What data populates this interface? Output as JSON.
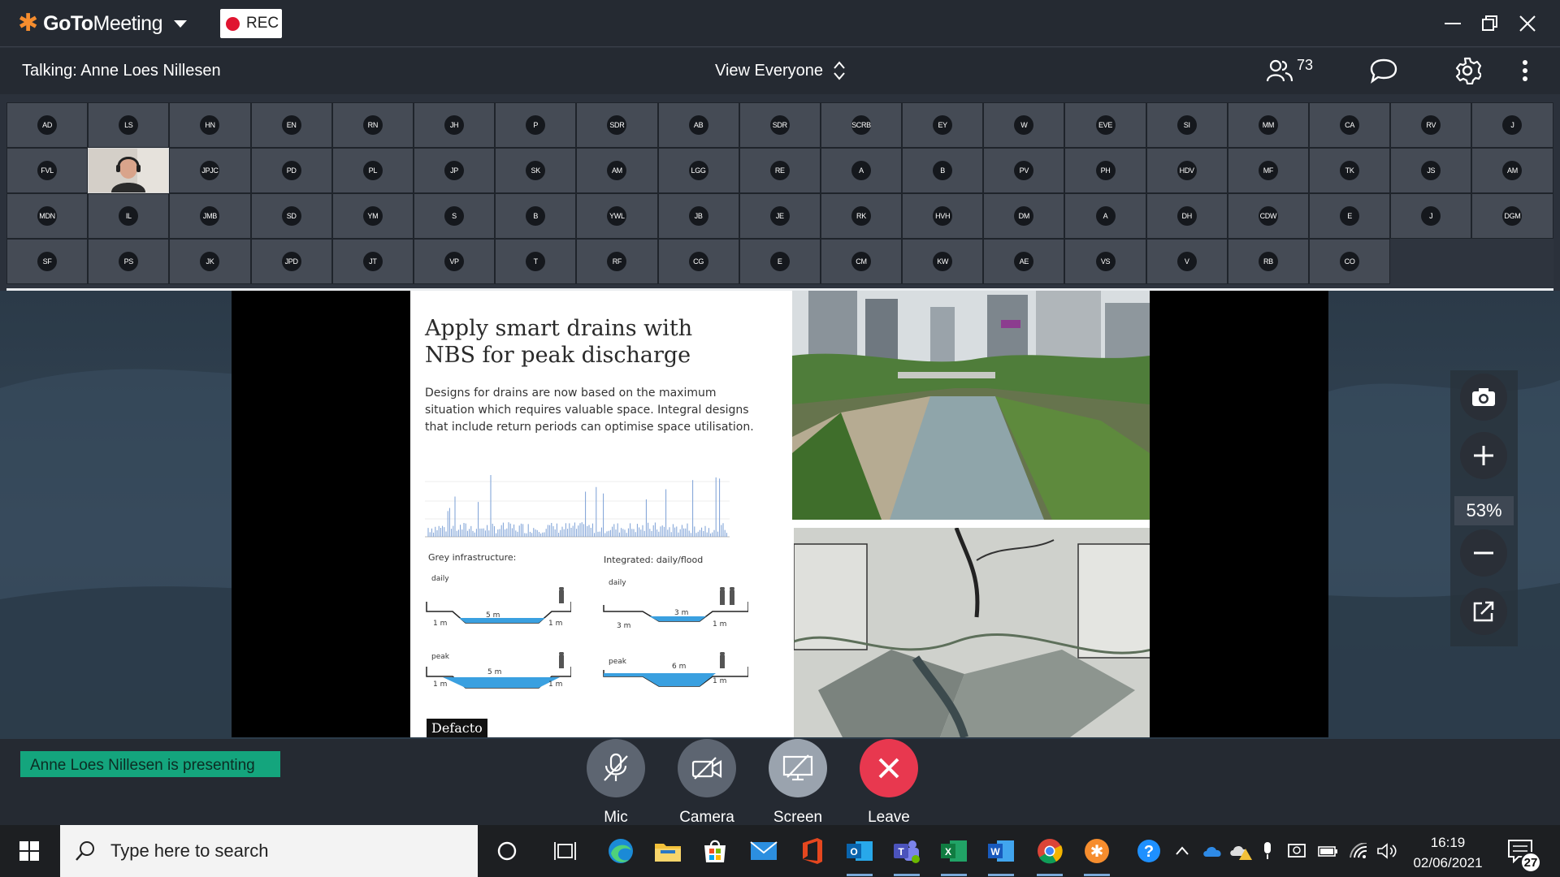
{
  "app": {
    "name_bold": "GoTo",
    "name_rest": "Meeting",
    "rec_label": "REC"
  },
  "infobar": {
    "talking": "Talking: Anne Loes Nillesen",
    "view_label": "View Everyone",
    "attendee_count": "73"
  },
  "participants": [
    "AD",
    "LS",
    "HN",
    "EN",
    "RN",
    "JH",
    "P",
    "SDR",
    "AB",
    "SDR",
    "SCRB",
    "EY",
    "W",
    "EVE",
    "SI",
    "MM",
    "CA",
    "RV",
    "J",
    "FVL",
    "",
    "JPJC",
    "PD",
    "PL",
    "JP",
    "SK",
    "AM",
    "LGG",
    "RE",
    "A",
    "B",
    "PV",
    "PH",
    "HDV",
    "MF",
    "TK",
    "JS",
    "AM",
    "MDN",
    "IL",
    "JMB",
    "SD",
    "YM",
    "S",
    "B",
    "YWL",
    "JB",
    "JE",
    "RK",
    "HVH",
    "DM",
    "A",
    "DH",
    "CDW",
    "E",
    "J",
    "DGM",
    "SF",
    "PS",
    "JK",
    "JPD",
    "JT",
    "VP",
    "T",
    "RF",
    "CG",
    "E",
    "CM",
    "KW",
    "AE",
    "VS",
    "V",
    "RB",
    "CO"
  ],
  "slide": {
    "title_line1": "Apply smart drains with",
    "title_line2": "NBS for peak discharge",
    "body": "Designs for drains are now based on the maximum situation which requires valuable space. Integral designs that include return periods can optimise space utilisation.",
    "grey_label": "Grey infrastructure:",
    "integrated_label": "Integrated: daily/flood",
    "daily": "daily",
    "peak": "peak",
    "m5": "5 m",
    "m3": "3 m",
    "m6": "6 m",
    "m1": "1 m",
    "brand": "Defacto"
  },
  "zoom": {
    "percent": "53%"
  },
  "bottom": {
    "presenting": "Anne Loes Nillesen is presenting",
    "mic": "Mic",
    "camera": "Camera",
    "screen": "Screen",
    "leave": "Leave"
  },
  "taskbar": {
    "search_placeholder": "Type here to search",
    "time": "16:19",
    "date": "02/06/2021",
    "notifications": "27"
  },
  "colors": {
    "accent_orange": "#f68d2e",
    "rec_red": "#e01530",
    "presenting_green": "#14a57d",
    "leave_red": "#e8384f"
  },
  "icons": [
    "people-icon",
    "chat-icon",
    "gear-icon",
    "more-vertical-icon",
    "camera-snapshot-icon",
    "zoom-in-icon",
    "zoom-out-icon",
    "popout-icon",
    "mic-off-icon",
    "camera-off-icon",
    "screen-share-off-icon",
    "leave-icon"
  ]
}
